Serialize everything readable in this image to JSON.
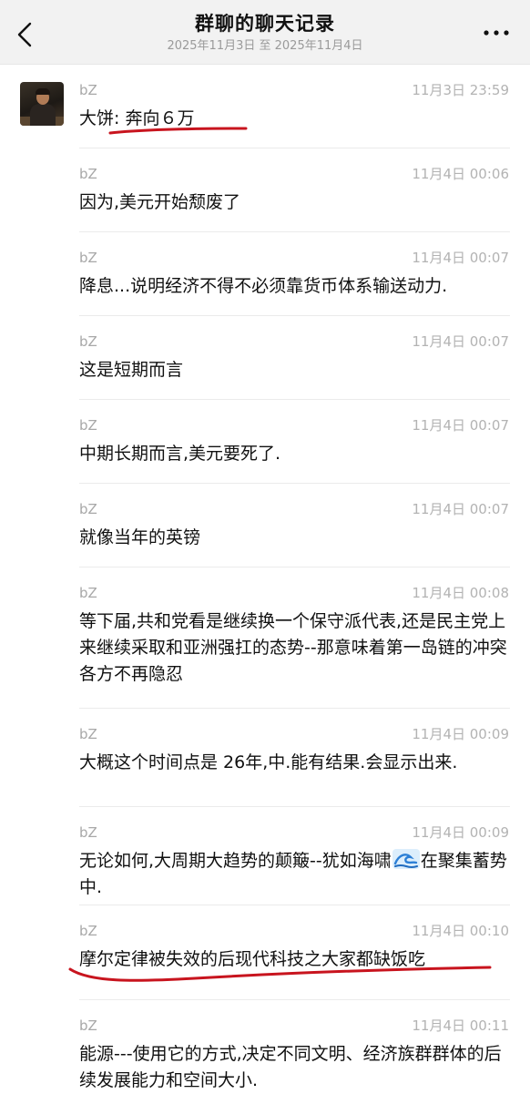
{
  "header": {
    "title": "群聊的聊天记录",
    "date_range": "2025年11月3日 至 2025年11月4日",
    "back_icon": "chevron-left-icon",
    "more_icon": "more-dots-icon"
  },
  "messages": [
    {
      "sender": "bZ",
      "time": "11月3日 23:59",
      "text": "大饼: 奔向６万"
    },
    {
      "sender": "bZ",
      "time": "11月4日 00:06",
      "text": "因为,美元开始颓废了"
    },
    {
      "sender": "bZ",
      "time": "11月4日 00:07",
      "text": "降息...说明经济不得不必须靠货币体系输送动力."
    },
    {
      "sender": "bZ",
      "time": "11月4日 00:07",
      "text": "这是短期而言"
    },
    {
      "sender": "bZ",
      "time": "11月4日 00:07",
      "text": "中期长期而言,美元要死了."
    },
    {
      "sender": "bZ",
      "time": "11月4日 00:07",
      "text": "就像当年的英镑"
    },
    {
      "sender": "bZ",
      "time": "11月4日 00:08",
      "text": "等下届,共和党看是继续换一个保守派代表,还是民主党上来继续采取和亚洲强扛的态势--那意味着第一岛链的冲突各方不再隐忍"
    },
    {
      "sender": "bZ",
      "time": "11月4日 00:09",
      "text": "大概这个时间点是 26年,中.能有结果.会显示出来."
    },
    {
      "sender": "bZ",
      "time": "11月4日 00:09",
      "text_before_icon": "无论如何,大周期大趋势的颠簸--犹如海啸",
      "icon": "wave-icon",
      "text_after_icon": "在聚集蓄势中."
    },
    {
      "sender": "bZ",
      "time": "11月4日 00:10",
      "text": "摩尔定律被失效的后现代科技之大家都缺饭吃"
    },
    {
      "sender": "bZ",
      "time": "11月4日 00:11",
      "text": "能源---使用它的方式,决定不同文明、经济族群群体的后续发展能力和空间大小."
    }
  ],
  "colors": {
    "header_bg": "#f2f2f2",
    "annotation_red": "#c8141e",
    "name_gray": "#a8a8a8",
    "text": "#111111"
  }
}
